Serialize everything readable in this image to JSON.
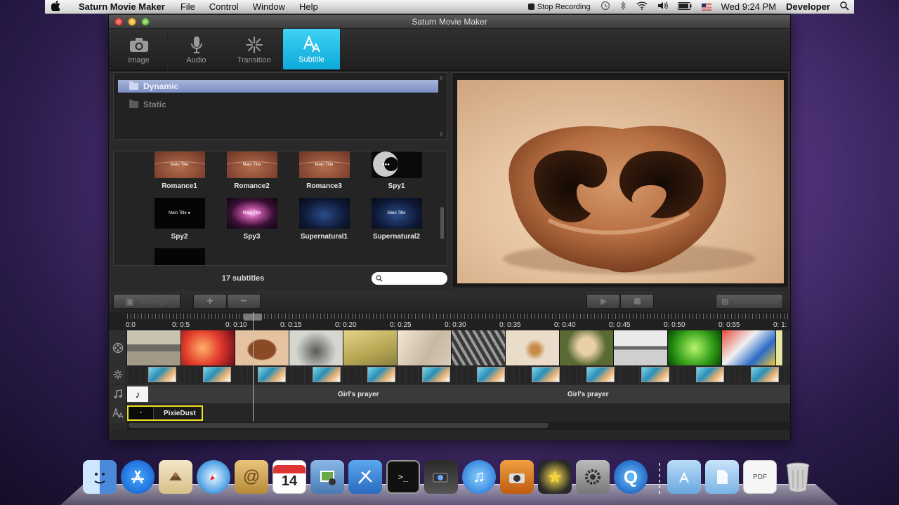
{
  "menubar": {
    "app_name": "Saturn Movie Maker",
    "menus": [
      "File",
      "Control",
      "Window",
      "Help"
    ],
    "stop_recording": "Stop Recording",
    "clock": "Wed 9:24 PM",
    "user": "Developer"
  },
  "window": {
    "title": "Saturn Movie Maker"
  },
  "toolbar": {
    "tools": [
      {
        "label": "Image",
        "icon": "camera-icon"
      },
      {
        "label": "Audio",
        "icon": "microphone-icon"
      },
      {
        "label": "Transition",
        "icon": "sparkle-icon"
      },
      {
        "label": "Subtitle",
        "icon": "subtitle-icon"
      }
    ],
    "active": "Subtitle"
  },
  "categories": [
    {
      "label": "Dynamic",
      "selected": true
    },
    {
      "label": "Static",
      "selected": false
    }
  ],
  "subtitles": {
    "items": [
      {
        "label": "Romance1",
        "caption": "Main Title"
      },
      {
        "label": "Romance2",
        "caption": "Main Title"
      },
      {
        "label": "Romance3",
        "caption": "Main Title"
      },
      {
        "label": "Spy1",
        "caption": "●●●"
      },
      {
        "label": "Spy2",
        "caption": "Main Title ●"
      },
      {
        "label": "Spy3",
        "caption": "Main Title"
      },
      {
        "label": "Supernatural1",
        "caption": ""
      },
      {
        "label": "Supernatural2",
        "caption": "Main Title"
      },
      {
        "label": "",
        "caption": ""
      }
    ],
    "count_text": "17 subtitles",
    "search_placeholder": ""
  },
  "controls": {
    "change_label": "Change",
    "add_symbol": "+",
    "remove_symbol": "−",
    "build_label": "Build Movie"
  },
  "timeline": {
    "ticks": [
      "0:0",
      "0: 0:5",
      "0: 0:10",
      "0: 0:15",
      "0: 0:20",
      "0: 0:25",
      "0: 0:30",
      "0: 0:35",
      "0: 0:40",
      "0: 0:45",
      "0: 0:50",
      "0: 0:55",
      "0: 1:"
    ],
    "audio_clips": [
      "Girl's prayer",
      "Girl's prayer"
    ],
    "subtitle_clip": "PixieDust"
  },
  "colors": {
    "accent": "#0da9da",
    "selection": "#8c9dcc",
    "clip_border": "#f0e020"
  }
}
